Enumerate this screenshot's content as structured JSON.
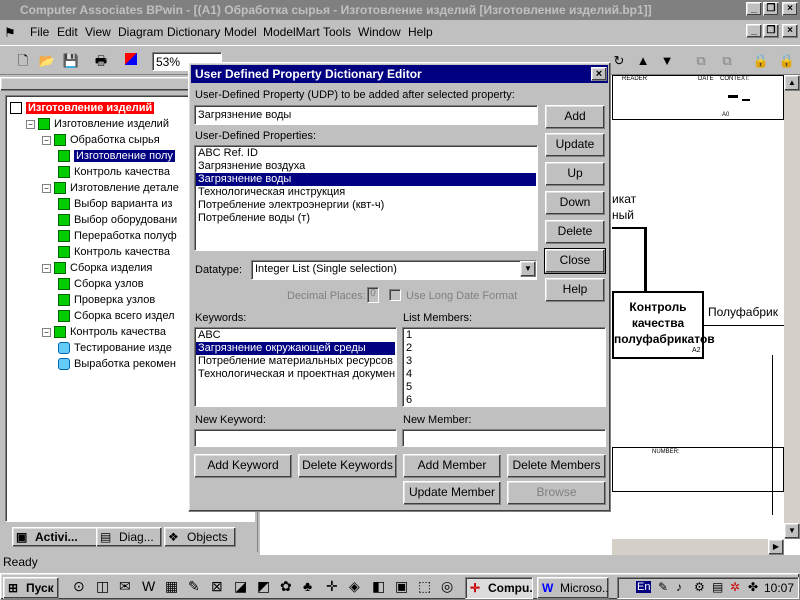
{
  "window": {
    "title": "Computer Associates BPwin - [(A1) Обработка  сырья - Изготовление изделий  [Изготовление изделий.bp1]]"
  },
  "menu": [
    "File",
    "Edit",
    "View",
    "Diagram",
    "Dictionary",
    "Model",
    "ModelMart",
    "Tools",
    "Window",
    "Help"
  ],
  "toolbar": {
    "zoom": "53%"
  },
  "tree": [
    {
      "label": "Изготовление изделий",
      "level": 0,
      "icon": "root",
      "highlight": true
    },
    {
      "label": "Изготовление изделий",
      "level": 1,
      "icon": "green"
    },
    {
      "label": "Обработка  сырья",
      "level": 2,
      "icon": "green"
    },
    {
      "label": "Изготовление полу",
      "level": 3,
      "icon": "green",
      "selected": true
    },
    {
      "label": "Контроль качества",
      "level": 3,
      "icon": "green"
    },
    {
      "label": "Изготовление  детале",
      "level": 2,
      "icon": "green"
    },
    {
      "label": "Выбор  варианта из",
      "level": 3,
      "icon": "green"
    },
    {
      "label": "Выбор оборудовани",
      "level": 3,
      "icon": "green"
    },
    {
      "label": "Переработка полуф",
      "level": 3,
      "icon": "green"
    },
    {
      "label": "Контроль качества",
      "level": 3,
      "icon": "green"
    },
    {
      "label": "Сборка изделия",
      "level": 2,
      "icon": "green"
    },
    {
      "label": "Сборка узлов",
      "level": 3,
      "icon": "green"
    },
    {
      "label": "Проверка узлов",
      "level": 3,
      "icon": "green"
    },
    {
      "label": "Сборка всего издел",
      "level": 3,
      "icon": "green"
    },
    {
      "label": "Контроль качества",
      "level": 2,
      "icon": "green"
    },
    {
      "label": "Тестирование изде",
      "level": 3,
      "icon": "blue"
    },
    {
      "label": "Выработка рекомен",
      "level": 3,
      "icon": "blue"
    }
  ],
  "tabs": [
    "Activi...",
    "Diag...",
    "Objects"
  ],
  "status": "Ready",
  "taskbar": {
    "start": "Пуск",
    "tasks": [
      "Compu...",
      "Microso..."
    ],
    "lang": "En",
    "clock": "10:07"
  },
  "diagram": {
    "reader": "READER",
    "date": "DATE",
    "context": "CONTEXT:",
    "a0": "A0",
    "frag1": "икат",
    "frag2": "ный",
    "box_title": "Контроль качества полуфабрикатов",
    "box_num": "A2",
    "arrow_label": "Полуфабрик",
    "number": "NUMBER:"
  },
  "dialog": {
    "title": "User Defined Property Dictionary Editor",
    "udp_label": "User-Defined Property (UDP)  to be added after selected property:",
    "udp_value": "Загрязнение воды",
    "udps_label": "User-Defined Properties:",
    "udps": [
      "ABC Ref. ID",
      "Загрязнение воздуха",
      "Загрязнение воды",
      "Технологическая инструкция",
      "Потребление электроэнергии (квт-ч)",
      "Потребление воды (т)"
    ],
    "udps_selected": 2,
    "datatype_label": "Datatype:",
    "datatype_value": "Integer List (Single selection)",
    "decimal_label": "Decimal Places:",
    "decimal_value": "0",
    "longdate_label": "Use Long Date Format",
    "keywords_label": "Keywords:",
    "keywords": [
      "ABC",
      "Загрязнение окружающей среды",
      "Потребление материальных ресурсов",
      "Технологическая и проектная докумен"
    ],
    "keywords_selected": 1,
    "members_label": "List Members:",
    "members": [
      "1",
      "2",
      "3",
      "4",
      "5",
      "6"
    ],
    "new_keyword_label": "New Keyword:",
    "new_member_label": "New Member:",
    "buttons": {
      "add": "Add",
      "update": "Update",
      "up": "Up",
      "down": "Down",
      "delete": "Delete",
      "close": "Close",
      "help": "Help",
      "add_keyword": "Add Keyword",
      "delete_keywords": "Delete Keywords",
      "add_member": "Add Member",
      "delete_members": "Delete Members",
      "update_member": "Update Member",
      "browse": "Browse"
    }
  }
}
